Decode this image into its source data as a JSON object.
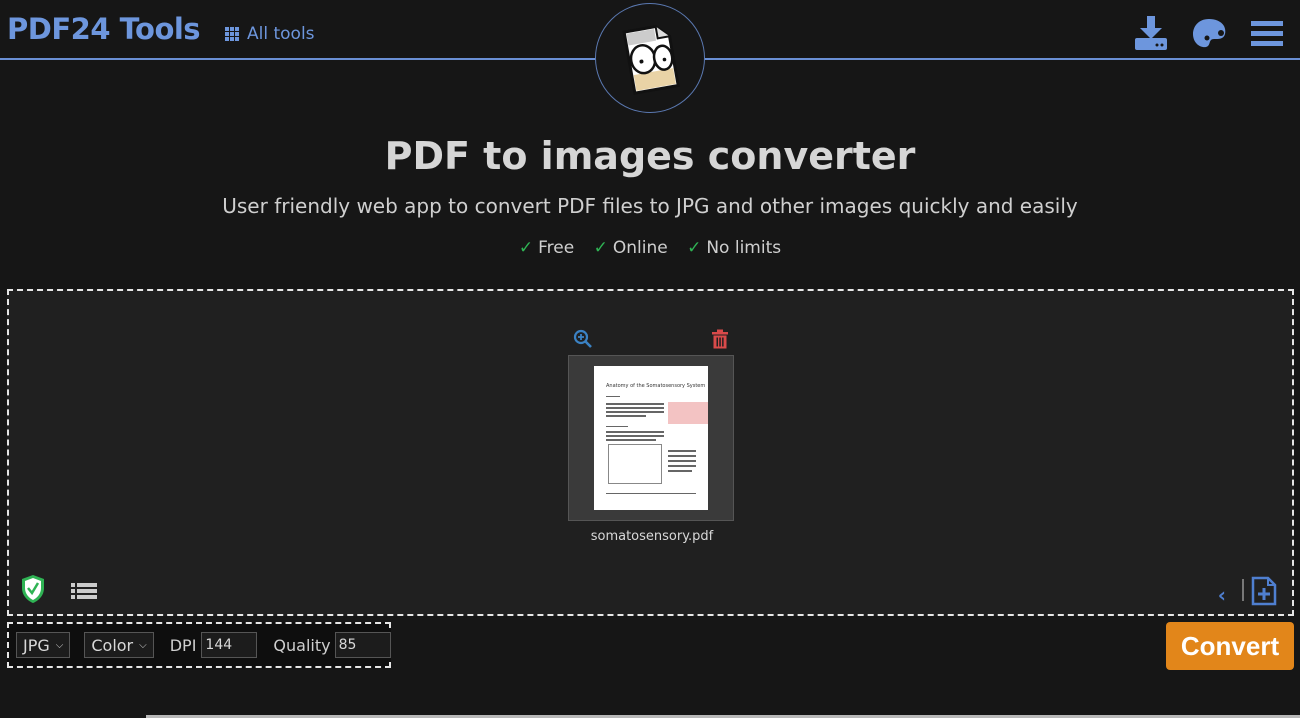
{
  "header": {
    "brand": "PDF24 Tools",
    "all_tools_label": "All tools",
    "icons": [
      "download-icon",
      "palette-icon",
      "menu-icon"
    ]
  },
  "hero": {
    "title": "PDF to images converter",
    "subtitle": "User friendly web app to convert PDF files to JPG and other images quickly and easily",
    "features": [
      "Free",
      "Online",
      "No limits"
    ],
    "check_color": "#2fb354"
  },
  "file": {
    "name": "somatosensory.pdf",
    "page_title": "Anatomy of the Somatosensory System"
  },
  "options": {
    "format": "JPG",
    "color_mode": "Color",
    "dpi_label": "DPI",
    "dpi_value": "144",
    "quality_label": "Quality",
    "quality_value": "85"
  },
  "actions": {
    "convert_label": "Convert",
    "prev_label": "‹"
  },
  "colors": {
    "accent": "#6d96dd",
    "convert": "#e2861a",
    "delete": "#d94a4a",
    "shield": "#2fb354"
  }
}
